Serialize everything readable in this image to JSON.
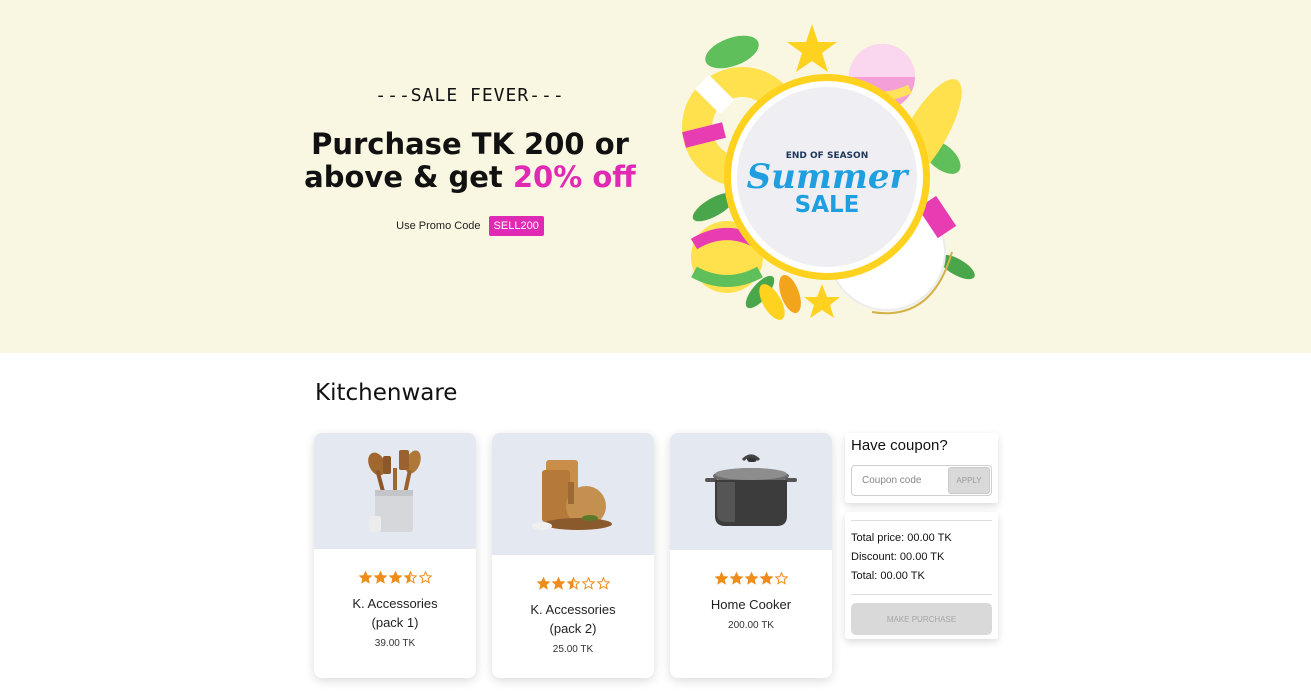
{
  "hero": {
    "kicker": "---SALE FEVER---",
    "headline_part1": "Purchase TK 200 or",
    "headline_part2": "above & get ",
    "headline_highlight": "20% off",
    "promo_label": "Use Promo Code",
    "promo_code": "SELL200",
    "banner_top": "END OF SEASON",
    "banner_main": "Summer",
    "banner_sub": "SALE",
    "accent_color": "#e02ab4",
    "background_color": "#f9f6e1"
  },
  "section": {
    "title": "Kitchenware"
  },
  "products": [
    {
      "name_line1": "K. Accessories",
      "name_line2": "(pack 1)",
      "price": "39.00 TK",
      "rating": 3.5,
      "icon": "wooden-utensils-icon"
    },
    {
      "name_line1": "K. Accessories",
      "name_line2": "(pack 2)",
      "price": "25.00 TK",
      "rating": 2.5,
      "icon": "cutting-boards-icon"
    },
    {
      "name_line1": "Home Cooker",
      "name_line2": "",
      "price": "200.00 TK",
      "rating": 4,
      "icon": "cooking-pot-icon"
    }
  ],
  "coupon": {
    "title": "Have coupon?",
    "placeholder": "Coupon code",
    "apply_label": "APPLY"
  },
  "summary": {
    "total_price": "Total price: 00.00 TK",
    "discount": "Discount: 00.00 TK",
    "total": "Total: 00.00 TK",
    "purchase_label": "MAKE PURCHASE"
  },
  "colors": {
    "star": "#ef8d1a",
    "card_image_bg": "#e4e8f0",
    "disabled_button": "#d9d9d9"
  }
}
